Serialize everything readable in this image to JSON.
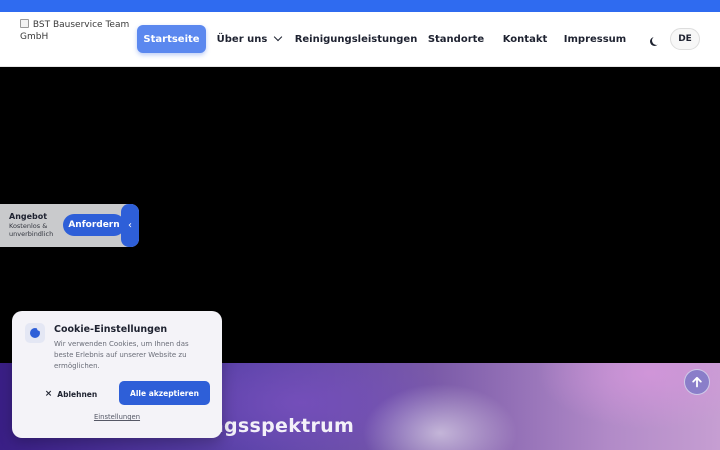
{
  "logo": {
    "alt_text": "BST Bauservice Team GmbH"
  },
  "nav": {
    "items": [
      {
        "label": "Startseite"
      },
      {
        "label": "Über uns"
      },
      {
        "label": "Reinigungsleistungen"
      },
      {
        "label": "Standorte"
      },
      {
        "label": "Kontakt"
      },
      {
        "label": "Impressum"
      }
    ],
    "active": "Startseite",
    "theme_icon": "moon-icon",
    "language": "DE"
  },
  "quote_widget": {
    "title": "Angebot",
    "subtitle": "Kostenlos & unverbindlich",
    "button": "Anfordern",
    "toggle_icon": "chevron-left-icon"
  },
  "hero": {
    "title": "Unser Leistungsspektrum"
  },
  "cookie_banner": {
    "icon": "cookie-icon",
    "title": "Cookie-Einstellungen",
    "text": "Wir verwenden Cookies, um Ihnen das beste Erlebnis auf unserer Website zu ermöglichen.",
    "decline_label": "Ablehnen",
    "accept_label": "Alle akzeptieren",
    "settings_label": "Einstellungen"
  },
  "colors": {
    "accent": "#2e5fd8",
    "active_nav": "#5b88ef",
    "topbar": "#2f6bf0"
  }
}
